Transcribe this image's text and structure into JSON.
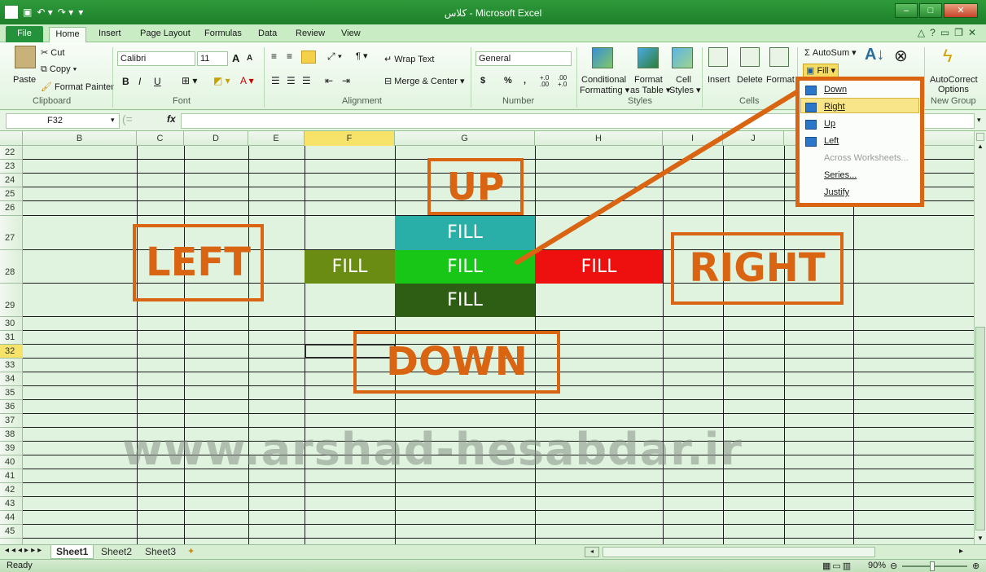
{
  "window": {
    "title": "کلاس - Microsoft Excel",
    "min": "–",
    "max": "□",
    "close": "✕"
  },
  "tabs": {
    "file": "File",
    "home": "Home",
    "insert": "Insert",
    "page_layout": "Page Layout",
    "formulas": "Formulas",
    "data": "Data",
    "review": "Review",
    "view": "View"
  },
  "clipboard": {
    "paste": "Paste",
    "cut": "Cut",
    "copy": "Copy ▾",
    "format_painter": "Format Painter",
    "label": "Clipboard"
  },
  "font": {
    "name": "Calibri",
    "size": "11",
    "bold": "B",
    "italic": "I",
    "underline": "U",
    "grow": "A",
    "shrink": "A",
    "label": "Font"
  },
  "alignment": {
    "wrap_text": "Wrap Text",
    "merge_center": "Merge & Center ▾",
    "label": "Alignment"
  },
  "number": {
    "format": "General",
    "currency": "$",
    "percent": "%",
    "comma": ",",
    "inc_dec": "+.0 .00",
    "dec_dec": ".00 +.0",
    "label": "Number"
  },
  "styles": {
    "conditional": "Conditional",
    "conditional2": "Formatting ▾",
    "format_as": "Format",
    "format_as2": "as Table ▾",
    "cell": "Cell",
    "cell2": "Styles ▾",
    "label": "Styles"
  },
  "cells": {
    "insert": "Insert",
    "delete": "Delete",
    "format": "Format",
    "label": "Cells"
  },
  "editing": {
    "autosum": "Σ AutoSum ▾",
    "fill": "Fill ▾"
  },
  "autocorrect": {
    "label1": "AutoCorrect",
    "label2": "Options",
    "group": "New Group"
  },
  "fill_menu": {
    "items": [
      {
        "label": "Down",
        "disabled": false
      },
      {
        "label": "Right",
        "disabled": false
      },
      {
        "label": "Up",
        "disabled": false
      },
      {
        "label": "Left",
        "disabled": false
      },
      {
        "label": "Across Worksheets...",
        "disabled": true
      },
      {
        "label": "Series...",
        "disabled": false
      },
      {
        "label": "Justify",
        "disabled": false
      }
    ]
  },
  "formula_bar": {
    "cell_ref": "F32",
    "fx": "fx",
    "value": ""
  },
  "columns": [
    "B",
    "C",
    "D",
    "E",
    "F",
    "G",
    "H",
    "I",
    "J",
    "K"
  ],
  "selected_column": "F",
  "rows": [
    "22",
    "23",
    "24",
    "25",
    "26",
    "27",
    "28",
    "29",
    "30",
    "31",
    "32",
    "33",
    "34",
    "35",
    "36",
    "37",
    "38",
    "39",
    "40",
    "41",
    "42",
    "43",
    "44",
    "45"
  ],
  "selected_row": "32",
  "fill_cells": {
    "up": "FILL",
    "left": "FILL",
    "center": "FILL",
    "right": "FILL",
    "down": "FILL"
  },
  "labels": {
    "up": "UP",
    "left": "LEFT",
    "right": "RIGHT",
    "down": "DOWN"
  },
  "watermark": "www.arshad-hesabdar.ir",
  "sheets": [
    "Sheet1",
    "Sheet2",
    "Sheet3"
  ],
  "active_sheet": "Sheet1",
  "status": {
    "ready": "Ready",
    "zoom": "90%"
  },
  "colors": {
    "fill_up": "#2aafa8",
    "fill_left": "#6a8c12",
    "fill_center": "#17c617",
    "fill_right": "#ee0f0f",
    "fill_down": "#2e5e14",
    "annotation": "#d96512"
  }
}
